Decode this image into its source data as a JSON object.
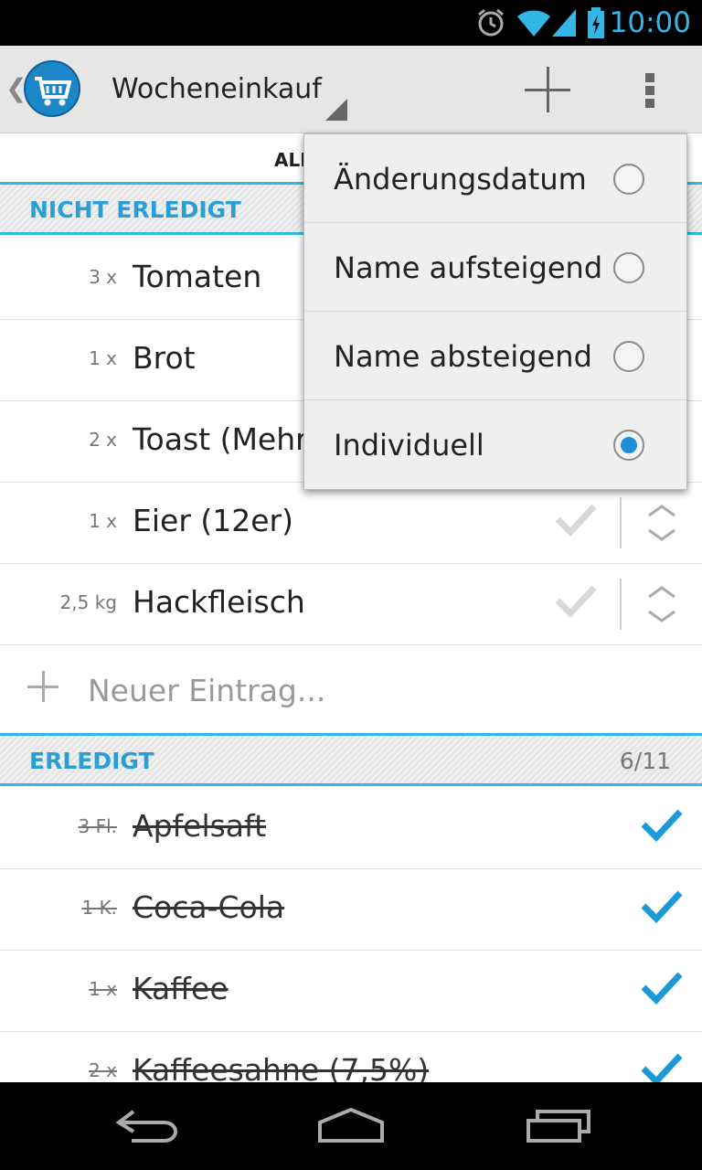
{
  "statusbar": {
    "time": "10:00"
  },
  "actionbar": {
    "title": "Wocheneinkauf"
  },
  "tab": {
    "label": "ALL"
  },
  "sections": {
    "open": {
      "title": "NICHT ERLEDIGT"
    },
    "done": {
      "title": "ERLEDIGT",
      "count": "6/11"
    }
  },
  "open_items": [
    {
      "qty": "3 x",
      "name": "Tomaten"
    },
    {
      "qty": "1 x",
      "name": "Brot"
    },
    {
      "qty": "2 x",
      "name": "Toast (Mehr"
    },
    {
      "qty": "1 x",
      "name": "Eier (12er)"
    },
    {
      "qty": "2,5 kg",
      "name": "Hackfleisch"
    }
  ],
  "new_entry": {
    "placeholder": "Neuer Eintrag..."
  },
  "done_items": [
    {
      "qty": "3 Fl.",
      "name": "Apfelsaft"
    },
    {
      "qty": "1 K.",
      "name": "Coca-Cola"
    },
    {
      "qty": "1 x",
      "name": "Kaffee"
    },
    {
      "qty": "2 x",
      "name": "Kaffeesahne (7,5%)"
    }
  ],
  "sort_menu": {
    "options": [
      {
        "label": "Änderungsdatum",
        "selected": false
      },
      {
        "label": "Name aufsteigend",
        "selected": false
      },
      {
        "label": "Name absteigend",
        "selected": false
      },
      {
        "label": "Individuell",
        "selected": true
      }
    ]
  },
  "colors": {
    "accent": "#33b5e5",
    "check": "#1c9ad8"
  }
}
